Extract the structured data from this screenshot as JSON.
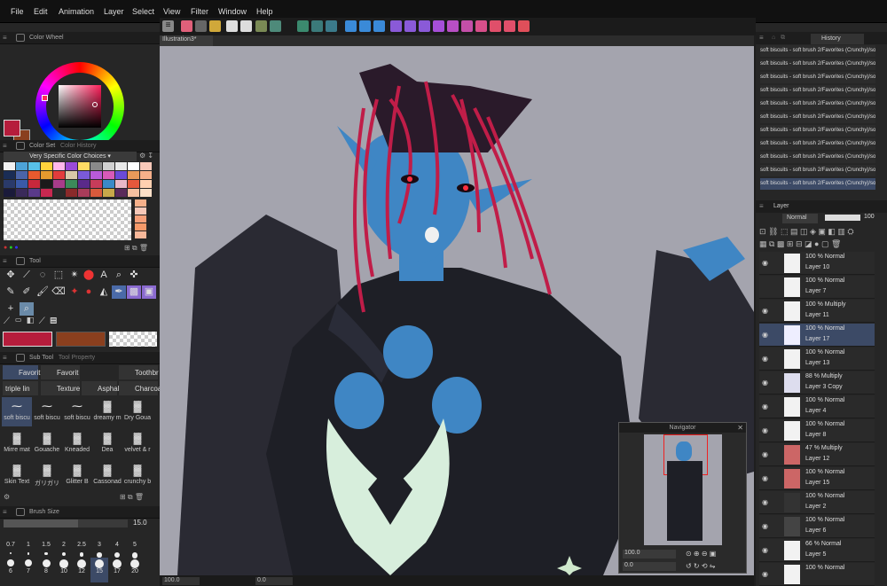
{
  "app": {
    "title": "Illustration3",
    "menu": [
      "File",
      "Edit",
      "Animation",
      "Layer",
      "Select",
      "View",
      "Filter",
      "Window",
      "Help"
    ]
  },
  "colors": {
    "main": "#b61d3c",
    "sub": "#8a3f1e",
    "accent": "#4a5f8c"
  },
  "left": {
    "color_wheel": {
      "title": "Color Wheel",
      "h": "347",
      "s": "84",
      "v": "58"
    },
    "color_set": {
      "tab1": "Color Set",
      "tab2": "Color History",
      "set_name": "Very Specific Color Choices"
    },
    "tool": {
      "title": "Tool"
    },
    "subtool": {
      "tab1": "Sub Tool",
      "tab2": "Tool Property",
      "tabs": [
        "Favorit",
        "Favorit",
        "Toothbr",
        "triple lin",
        "Texture",
        "Asphalt",
        "Charcoa"
      ]
    },
    "brushes": [
      "soft biscu",
      "soft biscu",
      "soft biscu",
      "dreamy m",
      "Dry Goua",
      "Mirre mat",
      "Gouache",
      "Kneaded",
      "Dea",
      "velvet & r",
      "Skin Text",
      "ガリガリ",
      "Glitter B",
      "Cassonad",
      "crunchy b"
    ],
    "brush_size": {
      "title": "Brush Size",
      "value": "15.0",
      "sizes": [
        "0.7",
        "1",
        "1.5",
        "2",
        "2.5",
        "3",
        "4",
        "5",
        "6",
        "7",
        "8",
        "10",
        "12",
        "15",
        "17",
        "20"
      ]
    }
  },
  "canvas": {
    "tab": "Illustration3*",
    "zoom": "100.0",
    "angle": "0.0"
  },
  "navigator": {
    "title": "Navigator",
    "zoom": "100.0",
    "angle": "0.0"
  },
  "right": {
    "history": {
      "tab": "History",
      "entries": [
        "soft biscuits - soft brush 2/Favorites (Crunchy)/soft bi",
        "soft biscuits - soft brush 2/Favorites (Crunchy)/soft bi",
        "soft biscuits - soft brush 2/Favorites (Crunchy)/soft bi",
        "soft biscuits - soft brush 2/Favorites (Crunchy)/soft bi",
        "soft biscuits - soft brush 2/Favorites (Crunchy)/soft bi",
        "soft biscuits - soft brush 2/Favorites (Crunchy)/soft bi",
        "soft biscuits - soft brush 2/Favorites (Crunchy)/soft bi",
        "soft biscuits - soft brush 2/Favorites (Crunchy)/soft bi",
        "soft biscuits - soft brush 2/Favorites (Crunchy)/soft bi",
        "soft biscuits - soft brush 2/Favorites (Crunchy)/soft bi",
        "soft biscuits - soft brush 2/Favorites (Crunchy)/soft bi"
      ]
    },
    "layer": {
      "title": "Layer",
      "blend": "Normal",
      "opacity": "100",
      "layers": [
        {
          "mode": "100 % Normal",
          "name": "Layer 10",
          "visible": true
        },
        {
          "mode": "100 % Normal",
          "name": "Layer 7",
          "visible": false
        },
        {
          "mode": "100 % Multiply",
          "name": "Layer 11",
          "visible": true
        },
        {
          "mode": "100 % Normal",
          "name": "Layer 17",
          "visible": true,
          "selected": true
        },
        {
          "mode": "100 % Normal",
          "name": "Layer 13",
          "visible": true
        },
        {
          "mode": "88 % Multiply",
          "name": "Layer 3 Copy",
          "visible": true
        },
        {
          "mode": "100 % Normal",
          "name": "Layer 4",
          "visible": true
        },
        {
          "mode": "100 % Normal",
          "name": "Layer 8",
          "visible": true
        },
        {
          "mode": "47 % Multiply",
          "name": "Layer 12",
          "visible": true
        },
        {
          "mode": "100 % Normal",
          "name": "Layer 15",
          "visible": true
        },
        {
          "mode": "100 % Normal",
          "name": "Layer 2",
          "visible": true
        },
        {
          "mode": "100 % Normal",
          "name": "Layer 6",
          "visible": true
        },
        {
          "mode": "66 % Normal",
          "name": "Layer 5",
          "visible": true
        },
        {
          "mode": "100 % Normal",
          "name": "",
          "visible": true
        }
      ]
    }
  }
}
